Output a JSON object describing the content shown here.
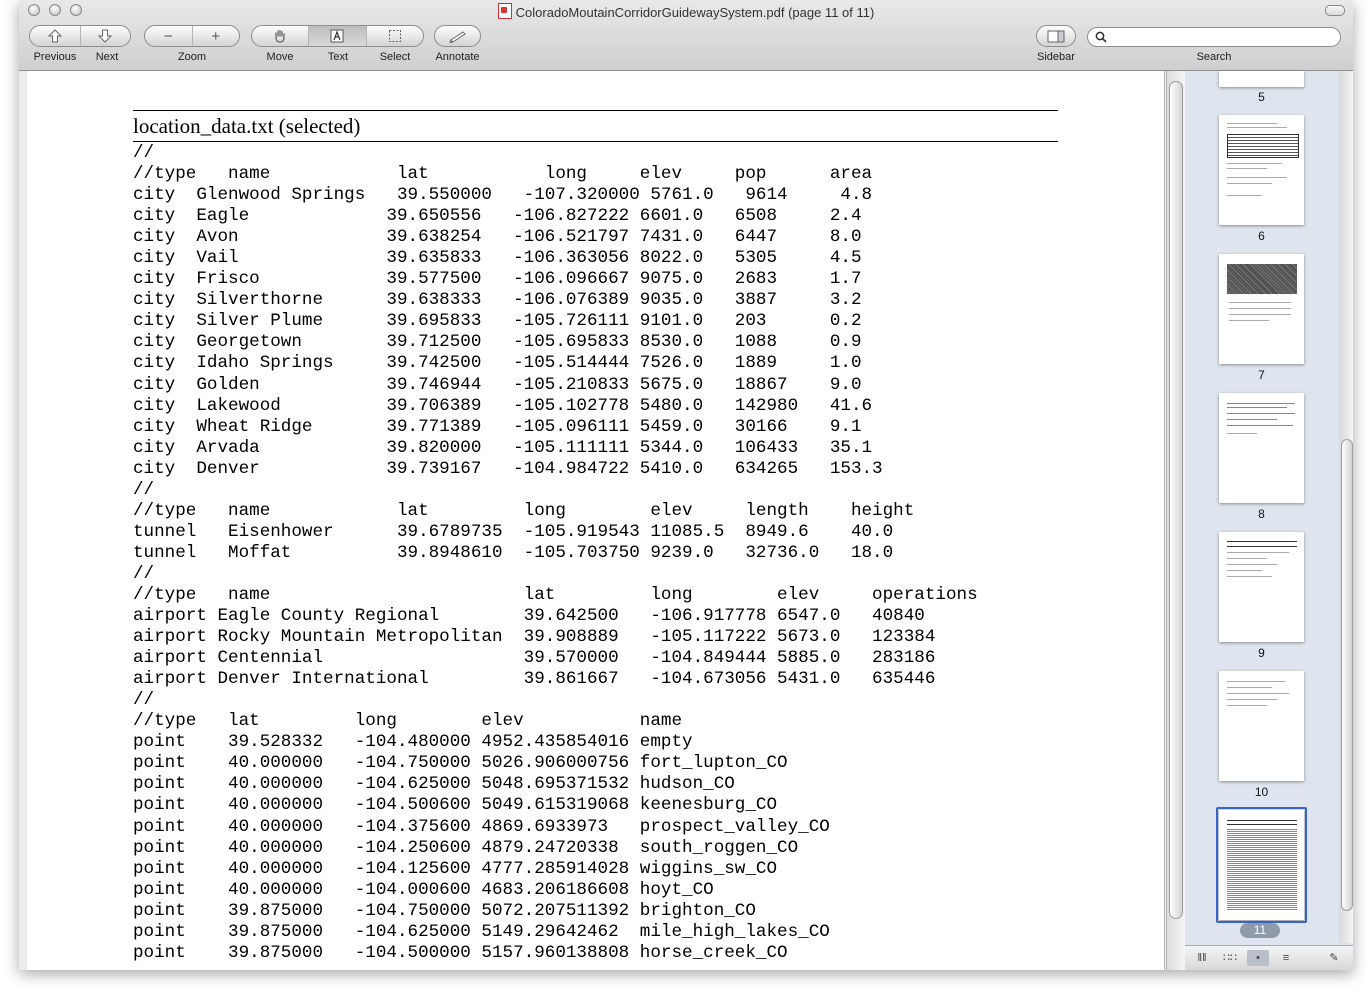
{
  "window": {
    "title": "ColoradoMoutainCorridorGuidewaySystem.pdf (page 11 of 11)"
  },
  "toolbar": {
    "previous_label": "Previous",
    "next_label": "Next",
    "zoom_label": "Zoom",
    "move_label": "Move",
    "text_label": "Text",
    "select_label": "Select",
    "annotate_label": "Annotate",
    "sidebar_label": "Sidebar",
    "search_label": "Search",
    "search_value": ""
  },
  "icons": {
    "previous": "up-arrow-icon",
    "next": "down-arrow-icon",
    "zoom_out": "minus-icon",
    "zoom_in": "plus-icon",
    "move": "hand-icon",
    "text": "text-cursor-icon",
    "select": "selection-icon",
    "annotate": "pencil-icon",
    "sidebar": "sidebar-icon",
    "search": "magnifier-icon"
  },
  "document": {
    "title": "location_data.txt (selected)",
    "lines": [
      "//",
      "//type   name            lat           long     elev     pop      area",
      "city  Glenwood Springs   39.550000   -107.320000 5761.0   9614     4.8",
      "city  Eagle             39.650556   -106.827222 6601.0   6508     2.4",
      "city  Avon              39.638254   -106.521797 7431.0   6447     8.0",
      "city  Vail              39.635833   -106.363056 8022.0   5305     4.5",
      "city  Frisco            39.577500   -106.096667 9075.0   2683     1.7",
      "city  Silverthorne      39.638333   -106.076389 9035.0   3887     3.2",
      "city  Silver Plume      39.695833   -105.726111 9101.0   203      0.2",
      "city  Georgetown        39.712500   -105.695833 8530.0   1088     0.9",
      "city  Idaho Springs     39.742500   -105.514444 7526.0   1889     1.0",
      "city  Golden            39.746944   -105.210833 5675.0   18867    9.0",
      "city  Lakewood          39.706389   -105.102778 5480.0   142980   41.6",
      "city  Wheat Ridge       39.771389   -105.096111 5459.0   30166    9.1",
      "city  Arvada            39.820000   -105.111111 5344.0   106433   35.1",
      "city  Denver            39.739167   -104.984722 5410.0   634265   153.3",
      "//",
      "//type   name            lat         long        elev     length    height",
      "tunnel   Eisenhower      39.6789735  -105.919543 11085.5  8949.6    40.0",
      "tunnel   Moffat          39.8948610  -105.703750 9239.0   32736.0   18.0",
      "//",
      "//type   name                        lat         long        elev     operations",
      "airport Eagle County Regional        39.642500   -106.917778 6547.0   40840",
      "airport Rocky Mountain Metropolitan  39.908889   -105.117222 5673.0   123384",
      "airport Centennial                   39.570000   -104.849444 5885.0   283186",
      "airport Denver International         39.861667   -104.673056 5431.0   635446",
      "//",
      "//type   lat         long        elev           name",
      "point    39.528332   -104.480000 4952.435854016 empty",
      "point    40.000000   -104.750000 5026.906000756 fort_lupton_CO",
      "point    40.000000   -104.625000 5048.695371532 hudson_CO",
      "point    40.000000   -104.500600 5049.615319068 keenesburg_CO",
      "point    40.000000   -104.375600 4869.6933973   prospect_valley_CO",
      "point    40.000000   -104.250600 4879.24720338  south_roggen_CO",
      "point    40.000000   -104.125600 4777.285914028 wiggins_sw_CO",
      "point    40.000000   -104.000600 4683.206186608 hoyt_CO",
      "point    39.875000   -104.750000 5072.207511392 brighton_CO",
      "point    39.875000   -104.625000 5149.29642462  mile_high_lakes_CO",
      "point    39.875000   -104.500000 5157.960138808 horse_creek_CO"
    ]
  },
  "sidebar": {
    "pages": [
      {
        "number": "5"
      },
      {
        "number": "6"
      },
      {
        "number": "7"
      },
      {
        "number": "8"
      },
      {
        "number": "9"
      },
      {
        "number": "10"
      },
      {
        "number": "11"
      }
    ],
    "selected_page": "11"
  },
  "colors": {
    "selection_frame": "#3a64c4",
    "sidebar_bg": "#dfe5ef"
  }
}
